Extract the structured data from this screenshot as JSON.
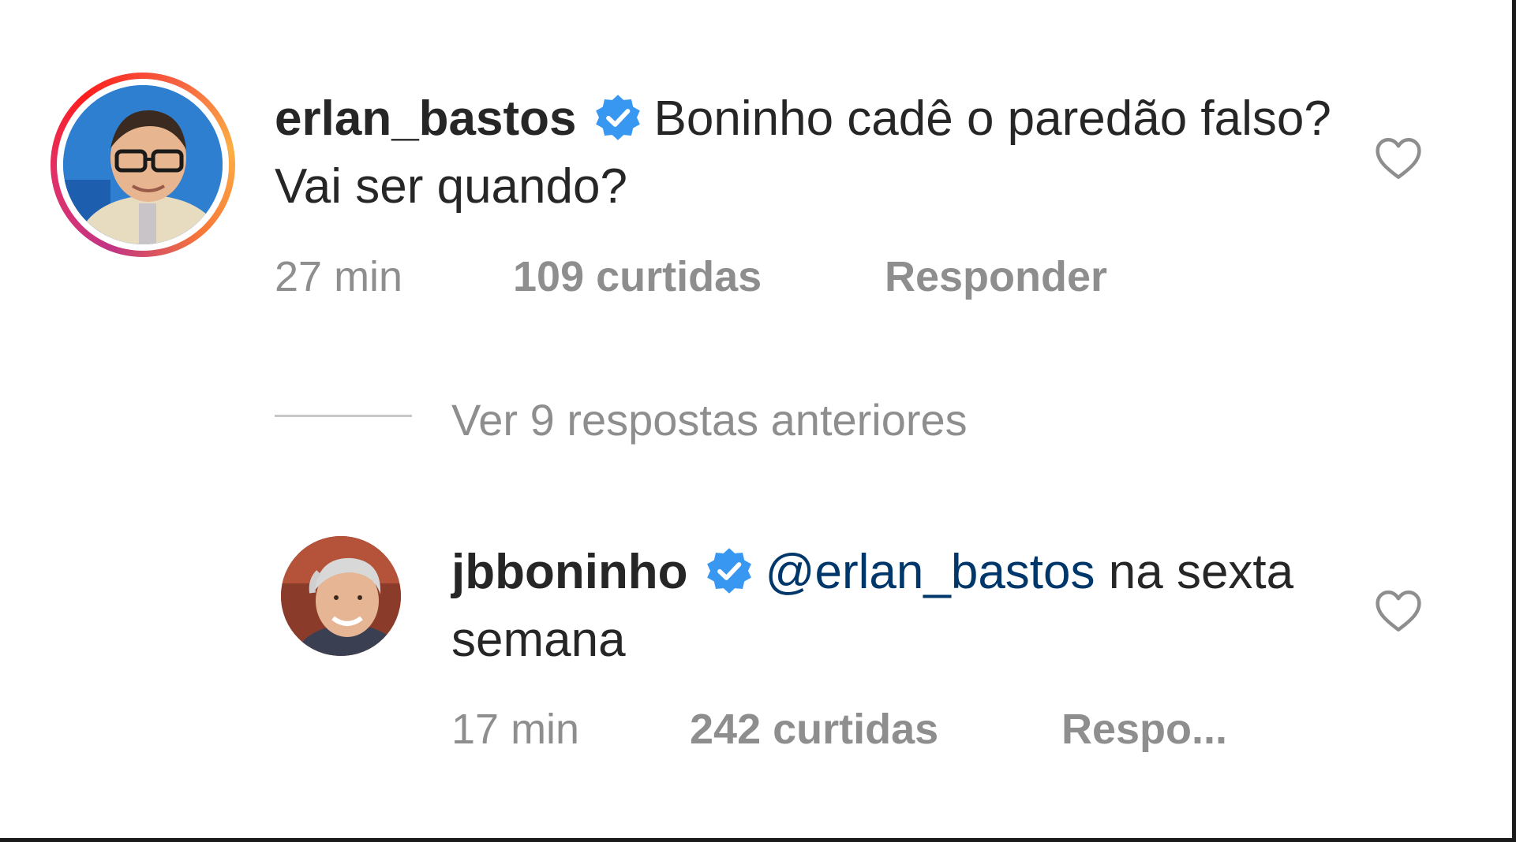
{
  "comment": {
    "username": "erlan_bastos",
    "text": "Boninho cadê o paredão falso? Vai ser quando?",
    "time": "27 min",
    "likes": "109 curtidas",
    "reply_label": "Responder",
    "liked": false
  },
  "view_replies": {
    "label": "Ver 9 respostas anteriores"
  },
  "reply": {
    "username": "jbboninho",
    "mention": "@erlan_bastos",
    "text": " na sexta semana",
    "time": "17 min",
    "likes": "242 curtidas",
    "reply_label": "Respo...",
    "liked": false
  },
  "colors": {
    "verified_badge": "#3897f0",
    "mention": "#00376b",
    "meta_text": "#8e8e8e",
    "primary_text": "#262626"
  },
  "icons": {
    "verified": "verified-badge-icon",
    "like": "heart-outline-icon"
  }
}
